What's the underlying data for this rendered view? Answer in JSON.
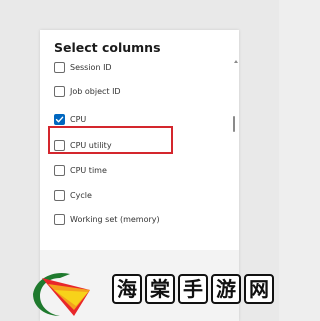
{
  "dialog": {
    "title": "Select columns",
    "columns": [
      {
        "label": "Session ID",
        "checked": false
      },
      {
        "label": "Job object ID",
        "checked": false
      },
      {
        "label": "CPU",
        "checked": true
      },
      {
        "label": "CPU utility",
        "checked": false
      },
      {
        "label": "CPU time",
        "checked": false
      },
      {
        "label": "Cycle",
        "checked": false
      },
      {
        "label": "Working set (memory)",
        "checked": false
      }
    ],
    "highlighted_column": "CPU utility"
  },
  "colors": {
    "accent": "#0067c0",
    "highlight": "#d4262d"
  },
  "watermark": {
    "chars": [
      "海",
      "棠",
      "手",
      "游",
      "网"
    ]
  }
}
